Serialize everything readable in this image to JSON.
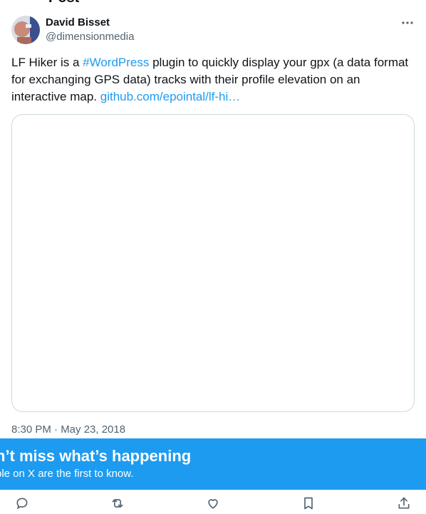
{
  "header": {
    "title": "Post"
  },
  "author": {
    "name": "David Bisset",
    "handle": "@dimensionmedia"
  },
  "tweet": {
    "text_1": "LF Hiker is a ",
    "hashtag": "#WordPress",
    "text_2": " plugin to quickly display your gpx (a data format for exchanging GPS data) tracks with their profile elevation on an interactive map. ",
    "link": "github.com/epointal/lf-hi…"
  },
  "timestamp": "8:30 PM · May 23, 2018",
  "banner": {
    "title": "n’t miss what’s happening",
    "subtitle": "ple on X are the first to know."
  },
  "actions": [
    "reply-icon",
    "repost-icon",
    "like-icon",
    "bookmark-icon",
    "share-icon"
  ],
  "colors": {
    "accent": "#1d9bf0",
    "text": "#0f1419",
    "secondary": "#536471",
    "border": "#cfd9de"
  }
}
